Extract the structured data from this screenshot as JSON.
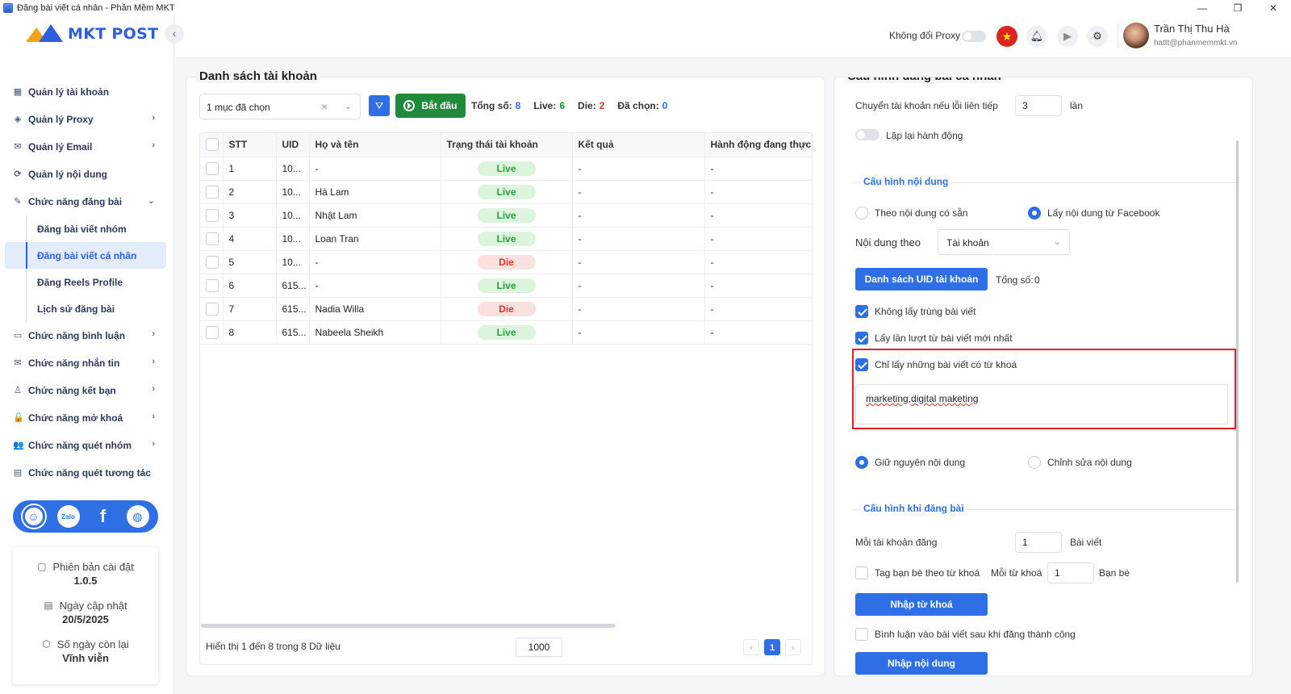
{
  "window": {
    "title": "Đăng bài viết cá nhân - Phần Mềm MKT",
    "controls": [
      "—",
      "❐",
      "✕"
    ]
  },
  "logo": {
    "text": "MKT POST"
  },
  "sidebar": {
    "items": [
      {
        "label": "Quản lý tài khoản",
        "icon": "▦"
      },
      {
        "label": "Quản lý Proxy",
        "icon": "◈",
        "chevron": "›"
      },
      {
        "label": "Quản lý Email",
        "icon": "✉",
        "chevron": "›"
      },
      {
        "label": "Quản lý nội dung",
        "icon": "⟳"
      },
      {
        "label": "Chức năng đăng bài",
        "icon": "✎",
        "chevron": "⌄"
      }
    ],
    "subitems": [
      "Đăng bài viết nhóm",
      "Đăng bài viết cá nhân",
      "Đăng Reels Profile",
      "Lịch sử đăng bài"
    ],
    "items2": [
      {
        "label": "Chức năng bình luận",
        "icon": "▭",
        "chevron": "›"
      },
      {
        "label": "Chức năng nhắn tin",
        "icon": "✉",
        "chevron": "›"
      },
      {
        "label": "Chức năng kết bạn",
        "icon": "♙",
        "chevron": "›"
      },
      {
        "label": "Chức năng mở khoá",
        "icon": "🔓",
        "chevron": "›"
      },
      {
        "label": "Chức năng quét nhóm",
        "icon": "👥",
        "chevron": "›"
      },
      {
        "label": "Chức năng quét tương tác",
        "icon": "▤"
      }
    ]
  },
  "social": [
    "☺",
    "Zalo",
    "f",
    "◍"
  ],
  "info": {
    "version_label": "Phiên bản cài đặt",
    "version": "1.0.5",
    "update_label": "Ngày cập nhật",
    "update": "20/5/2025",
    "days_label": "Số ngày còn lại",
    "days": "Vĩnh viễn"
  },
  "header": {
    "proxy_label": "Không đổi Proxy",
    "user_name": "Trần Thị Thu Hà",
    "user_email": "hattt@phanmemmkt.vn"
  },
  "left": {
    "title": "Danh sách tài khoản",
    "select_value": "1 mục đã chọn",
    "start_label": "Bắt đầu",
    "stats": {
      "total_label": "Tổng số:",
      "total": "8",
      "live_label": "Live:",
      "live": "6",
      "die_label": "Die:",
      "die": "2",
      "selected_label": "Đã chọn:",
      "selected": "0"
    },
    "columns": [
      "STT",
      "UID",
      "Họ và tên",
      "Trạng thái tài khoản",
      "Kết quả",
      "Hành động đang thực hiện"
    ],
    "rows": [
      {
        "stt": "1",
        "uid": "10...",
        "name": "-",
        "status": "Live",
        "result": "-",
        "action": "-"
      },
      {
        "stt": "2",
        "uid": "10...",
        "name": "Hà Lam",
        "status": "Live",
        "result": "-",
        "action": "-"
      },
      {
        "stt": "3",
        "uid": "10...",
        "name": "Nhật Lam",
        "status": "Live",
        "result": "-",
        "action": "-"
      },
      {
        "stt": "4",
        "uid": "10...",
        "name": "Loan Tran",
        "status": "Live",
        "result": "-",
        "action": "-"
      },
      {
        "stt": "5",
        "uid": "10...",
        "name": "-",
        "status": "Die",
        "result": "-",
        "action": "-"
      },
      {
        "stt": "6",
        "uid": "615...",
        "name": "-",
        "status": "Live",
        "result": "-",
        "action": "-"
      },
      {
        "stt": "7",
        "uid": "615...",
        "name": "Nadia Willa",
        "status": "Die",
        "result": "-",
        "action": "-"
      },
      {
        "stt": "8",
        "uid": "615...",
        "name": "Nabeela Sheikh",
        "status": "Live",
        "result": "-",
        "action": "-"
      }
    ],
    "footer": "Hiển thị 1 đến 8 trong 8 Dữ liệu",
    "page_size": "1000",
    "page": "1"
  },
  "right": {
    "title": "Cấu hình đăng bài cá nhân",
    "switch_label": "Chuyển tài khoản nếu lỗi liên tiếp",
    "switch_value": "3",
    "switch_unit": "lần",
    "repeat_label": "Lặp lại hành động",
    "content_section": "Cấu hình nội dung",
    "radio_existing": "Theo nội dung có sẵn",
    "radio_facebook": "Lấy nội dung từ Facebook",
    "content_by_label": "Nội dung theo",
    "content_by_value": "Tài khoản",
    "uid_button": "Danh sách UID tài khoản",
    "uid_total_label": "Tổng số:",
    "uid_total": "0",
    "chk_no_dup": "Không lấy trùng bài viết",
    "chk_newest": "Lấy lần lượt từ bài viết mới nhất",
    "chk_keyword": "Chỉ lấy những bài viết có từ khoá",
    "keywords": "marketing,digital maketing",
    "radio_keep": "Giữ nguyên nội dung",
    "radio_edit": "Chỉnh sửa nội dung",
    "post_section": "Cấu hình khi đăng bài",
    "per_account_label": "Mỗi tài khoản đăng",
    "per_account_value": "1",
    "per_account_unit": "Bài viết",
    "tag_label": "Tag bạn bè theo từ khoá",
    "per_keyword_label": "Mỗi từ khoá",
    "per_keyword_value": "1",
    "per_keyword_unit": "Bạn bè",
    "import_keyword_button": "Nhập từ khoá",
    "comment_label": "Bình luận vào bài viết sau khi đăng thành công",
    "import_content_button": "Nhập nội dung"
  }
}
